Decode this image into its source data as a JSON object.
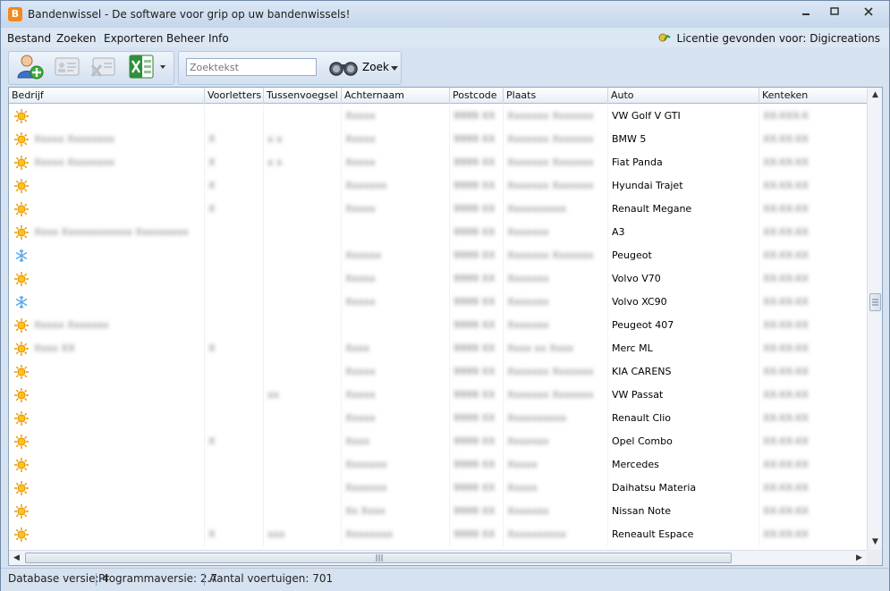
{
  "window": {
    "title": "Bandenwissel - De software voor grip op uw bandenwissels!",
    "app_icon_letter": "B"
  },
  "menu": {
    "items": [
      "Bestand",
      "Zoeken",
      "Exporteren",
      "Beheer",
      "Info"
    ],
    "license_label": "Licentie gevonden voor:",
    "license_holder": "Digicreations"
  },
  "toolbar": {
    "search_placeholder": "Zoektekst",
    "search_button_label": "Zoek"
  },
  "grid": {
    "columns": [
      "Bedrijf",
      "Voorletters",
      "Tussenvoegsel",
      "Achternaam",
      "Postcode",
      "Plaats",
      "Auto",
      "Kenteken"
    ],
    "rows": [
      {
        "season": "summer",
        "bedrijf": "",
        "voorletters": "",
        "tussenvoegsel": "",
        "achternaam": "Xxxxx",
        "postcode": "9999 XX",
        "plaats": "Xxxxxxx Xxxxxxx",
        "auto": "VW Golf V GTI",
        "kenteken": "XX-XXX-X"
      },
      {
        "season": "summer",
        "bedrijf": "Xxxxx Xxxxxxxx",
        "voorletters": "X",
        "tussenvoegsel": "x x",
        "achternaam": "Xxxxx",
        "postcode": "9999 XX",
        "plaats": "Xxxxxxx Xxxxxxx",
        "auto": "BMW 5",
        "kenteken": "XX-XX-XX"
      },
      {
        "season": "summer",
        "bedrijf": "Xxxxx Xxxxxxxx",
        "voorletters": "X",
        "tussenvoegsel": "x x",
        "achternaam": "Xxxxx",
        "postcode": "9999 XX",
        "plaats": "Xxxxxxx Xxxxxxx",
        "auto": "Fiat Panda",
        "kenteken": "XX-XX-XX"
      },
      {
        "season": "summer",
        "bedrijf": "",
        "voorletters": "X",
        "tussenvoegsel": "",
        "achternaam": "Xxxxxxx",
        "postcode": "9999 XX",
        "plaats": "Xxxxxxx Xxxxxxx",
        "auto": "Hyundai Trajet",
        "kenteken": "XX-XX-XX"
      },
      {
        "season": "summer",
        "bedrijf": "",
        "voorletters": "X",
        "tussenvoegsel": "",
        "achternaam": "Xxxxx",
        "postcode": "9999 XX",
        "plaats": "Xxxxxxxxxx",
        "auto": "Renault Megane",
        "kenteken": "XX-XX-XX"
      },
      {
        "season": "summer",
        "bedrijf": "Xxxx Xxxxxxxxxxxx Xxxxxxxxx",
        "voorletters": "",
        "tussenvoegsel": "",
        "achternaam": "",
        "postcode": "9999 XX",
        "plaats": "Xxxxxxx",
        "auto": "A3",
        "kenteken": "XX-XX-XX"
      },
      {
        "season": "winter",
        "bedrijf": "",
        "voorletters": "",
        "tussenvoegsel": "",
        "achternaam": "Xxxxxx",
        "postcode": "9999 XX",
        "plaats": "Xxxxxxx Xxxxxxx",
        "auto": "Peugeot",
        "kenteken": "XX-XX-XX"
      },
      {
        "season": "summer",
        "bedrijf": "",
        "voorletters": "",
        "tussenvoegsel": "",
        "achternaam": "Xxxxx",
        "postcode": "9999 XX",
        "plaats": "Xxxxxxx",
        "auto": "Volvo V70",
        "kenteken": "XX-XX-XX"
      },
      {
        "season": "winter",
        "bedrijf": "",
        "voorletters": "",
        "tussenvoegsel": "",
        "achternaam": "Xxxxx",
        "postcode": "9999 XX",
        "plaats": "Xxxxxxx",
        "auto": "Volvo XC90",
        "kenteken": "XX-XX-XX"
      },
      {
        "season": "summer",
        "bedrijf": "Xxxxx Xxxxxxx",
        "voorletters": "",
        "tussenvoegsel": "",
        "achternaam": "",
        "postcode": "9999 XX",
        "plaats": "Xxxxxxx",
        "auto": "Peugeot 407",
        "kenteken": "XX-XX-XX"
      },
      {
        "season": "summer",
        "bedrijf": "Xxxx XX",
        "voorletters": "X",
        "tussenvoegsel": "",
        "achternaam": "Xxxx",
        "postcode": "9999 XX",
        "plaats": "Xxxx xx Xxxx",
        "auto": "Merc ML",
        "kenteken": "XX-XX-XX"
      },
      {
        "season": "summer",
        "bedrijf": "",
        "voorletters": "",
        "tussenvoegsel": "",
        "achternaam": "Xxxxx",
        "postcode": "9999 XX",
        "plaats": "Xxxxxxx Xxxxxxx",
        "auto": "KIA CARENS",
        "kenteken": "XX-XX-XX"
      },
      {
        "season": "summer",
        "bedrijf": "",
        "voorletters": "",
        "tussenvoegsel": "xx",
        "achternaam": "Xxxxx",
        "postcode": "9999 XX",
        "plaats": "Xxxxxxx Xxxxxxx",
        "auto": "VW Passat",
        "kenteken": "XX-XX-XX"
      },
      {
        "season": "summer",
        "bedrijf": "",
        "voorletters": "",
        "tussenvoegsel": "",
        "achternaam": "Xxxxx",
        "postcode": "9999 XX",
        "plaats": "Xxxxxxxxxx",
        "auto": "Renault Clio",
        "kenteken": "XX-XX-XX"
      },
      {
        "season": "summer",
        "bedrijf": "",
        "voorletters": "X",
        "tussenvoegsel": "",
        "achternaam": "Xxxx",
        "postcode": "9999 XX",
        "plaats": "Xxxxxxx",
        "auto": "Opel Combo",
        "kenteken": "XX-XX-XX"
      },
      {
        "season": "summer",
        "bedrijf": "",
        "voorletters": "",
        "tussenvoegsel": "",
        "achternaam": "Xxxxxxx",
        "postcode": "9999 XX",
        "plaats": "Xxxxx",
        "auto": "Mercedes",
        "kenteken": "XX-XX-XX"
      },
      {
        "season": "summer",
        "bedrijf": "",
        "voorletters": "",
        "tussenvoegsel": "",
        "achternaam": "Xxxxxxx",
        "postcode": "9999 XX",
        "plaats": "Xxxxx",
        "auto": "Daihatsu Materia",
        "kenteken": "XX-XX-XX"
      },
      {
        "season": "summer",
        "bedrijf": "",
        "voorletters": "",
        "tussenvoegsel": "",
        "achternaam": "Xx Xxxx",
        "postcode": "9999 XX",
        "plaats": "Xxxxxxx",
        "auto": "Nissan Note",
        "kenteken": "XX-XX-XX"
      },
      {
        "season": "summer",
        "bedrijf": "",
        "voorletters": "X",
        "tussenvoegsel": "xxx",
        "achternaam": "Xxxxxxxx",
        "postcode": "9999 XX",
        "plaats": "Xxxxxxxxxx",
        "auto": "Reneault Espace",
        "kenteken": "XX-XX-XX"
      }
    ]
  },
  "status": {
    "db_version": "Database versie: 4",
    "program_version": "Programmaversie: 2.7",
    "vehicle_count": "Aantal voertuigen: 701"
  }
}
